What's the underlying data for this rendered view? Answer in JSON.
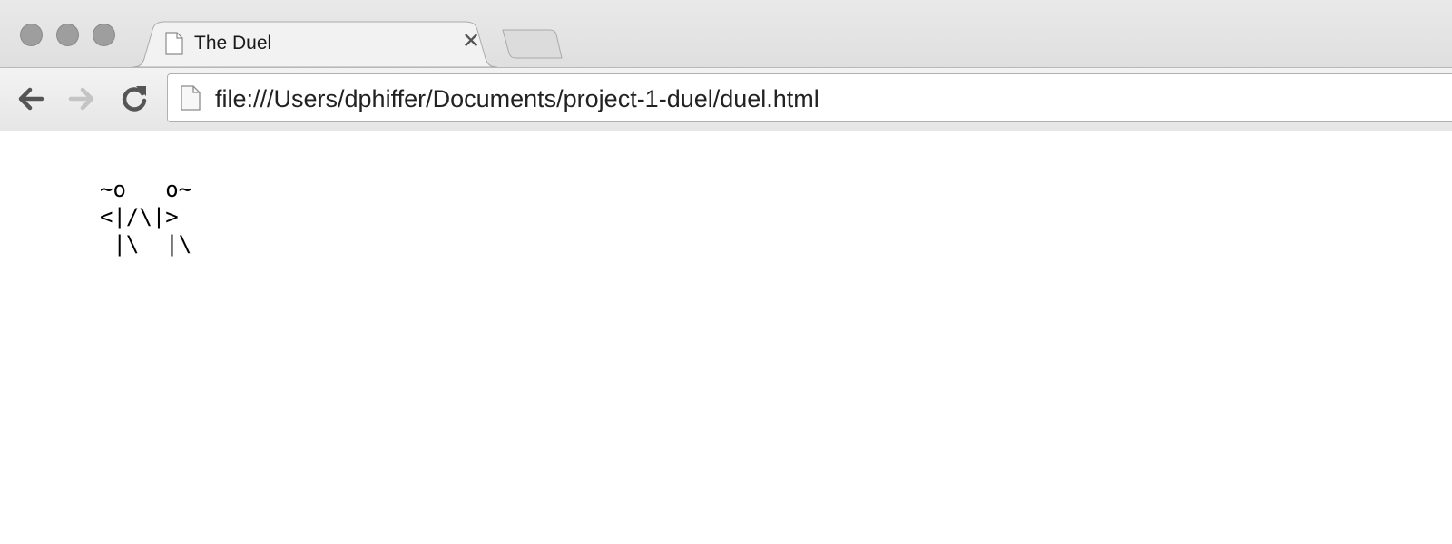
{
  "tab": {
    "title": "The Duel",
    "close_glyph": "✕",
    "page_icon": "page-icon"
  },
  "toolbar": {
    "back_icon": "back-arrow-icon",
    "forward_icon": "forward-arrow-icon",
    "reload_icon": "reload-icon"
  },
  "address_bar": {
    "url": "file:///Users/dphiffer/Documents/project-1-duel/duel.html",
    "page_icon": "page-icon"
  },
  "page": {
    "ascii_art": "~o   o~\n<|/\\|>\n |\\  |\\"
  },
  "colors": {
    "chrome_bg": "#e0e0e0",
    "traffic_light": "#9e9e9e",
    "forward_disabled": "#c4c4c4"
  }
}
